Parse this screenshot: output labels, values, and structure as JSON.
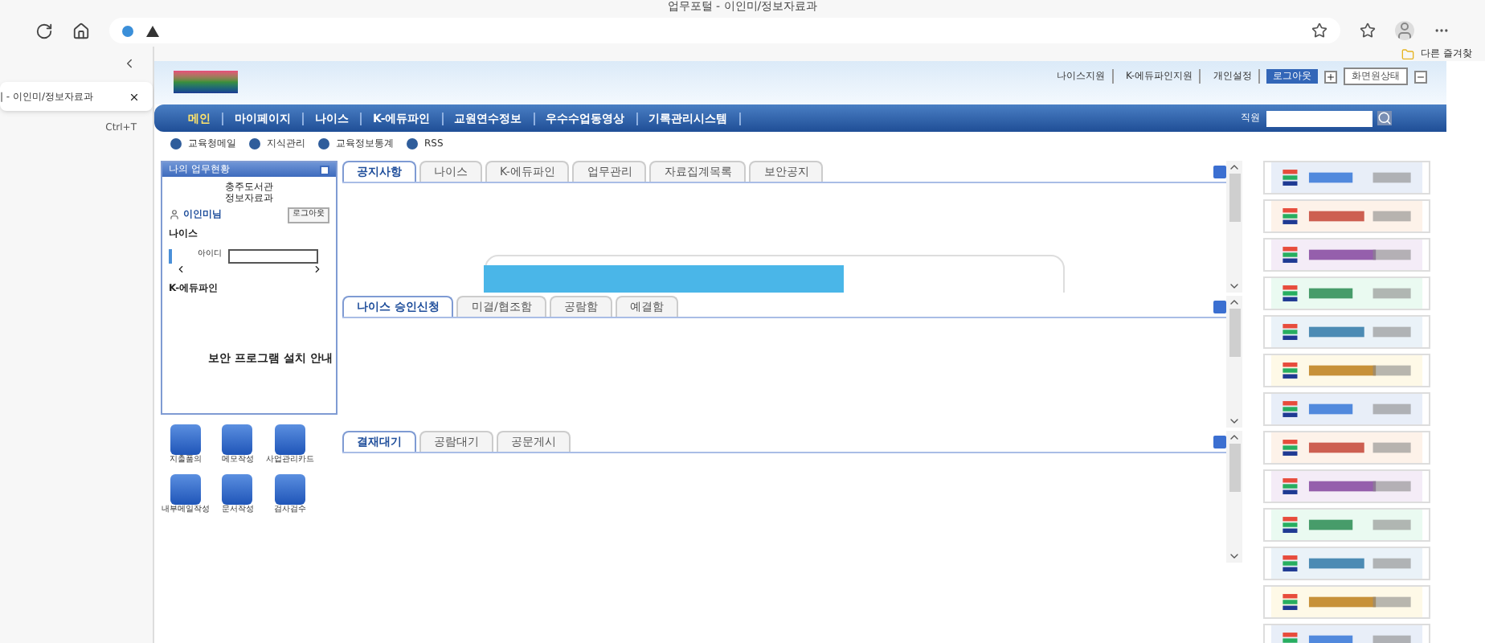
{
  "browser": {
    "title": "업무포털 - 이인미/정보자료과",
    "vertical_tab": {
      "label": "| - 이인미/정보자료과",
      "selected": true
    },
    "new_tab_shortcut": "Ctrl+T",
    "bookmark_folder": "다른 즐겨찾"
  },
  "top_links": [
    "나이스지원",
    "K-에듀파인지원",
    "개인설정"
  ],
  "logout_button": "로그아웃",
  "screen_button": "화면원상태",
  "nav": [
    {
      "label": "메인",
      "selected": true
    },
    {
      "label": "마이페이지",
      "selected": false
    },
    {
      "label": "나이스",
      "selected": false
    },
    {
      "label": "K-에듀파인",
      "selected": false
    },
    {
      "label": "교원연수정보",
      "selected": false
    },
    {
      "label": "우수수업동영상",
      "selected": false
    },
    {
      "label": "기록관리시스템",
      "selected": false
    }
  ],
  "search_scope": "직원",
  "sub_links": [
    "교육청메일",
    "지식관리",
    "교육정보통계",
    "RSS"
  ],
  "my_panel": {
    "title": "나의 업무현황",
    "org": "충주도서관 정보자료과",
    "user": "이인미님",
    "logout": "로그아웃",
    "sections": [
      "나이스",
      "K-에듀파인"
    ],
    "id_label": "아이디",
    "notice": "보안 프로그램 설치 안내"
  },
  "shortcuts": [
    "지출품의",
    "메모작성",
    "사업관리카드",
    "내부메일작성",
    "문서작성",
    "검사검수"
  ],
  "boards": [
    {
      "tabs": [
        {
          "label": "공지사항",
          "selected": true
        },
        {
          "label": "나이스",
          "selected": false
        },
        {
          "label": "K-에듀파인",
          "selected": false
        },
        {
          "label": "업무관리",
          "selected": false
        },
        {
          "label": "자료집계목록",
          "selected": false
        },
        {
          "label": "보안공지",
          "selected": false
        }
      ]
    },
    {
      "tabs": [
        {
          "label": "나이스 승인신청",
          "selected": true
        },
        {
          "label": "미결/협조함",
          "selected": false
        },
        {
          "label": "공람함",
          "selected": false
        },
        {
          "label": "예결함",
          "selected": false
        }
      ]
    },
    {
      "tabs": [
        {
          "label": "결재대기",
          "selected": true
        },
        {
          "label": "공람대기",
          "selected": false
        },
        {
          "label": "공문게시",
          "selected": false
        }
      ]
    }
  ],
  "banners": [
    {
      "kind": "picture"
    },
    {
      "kind": "picture"
    },
    {
      "kind": "picture"
    },
    {
      "kind": "picture"
    },
    {
      "kind": "picture"
    },
    {
      "kind": "picture"
    },
    {
      "kind": "picture"
    },
    {
      "kind": "picture"
    },
    {
      "kind": "picture"
    },
    {
      "kind": "picture"
    },
    {
      "kind": "picture"
    },
    {
      "kind": "picture"
    },
    {
      "kind": "picture"
    }
  ]
}
